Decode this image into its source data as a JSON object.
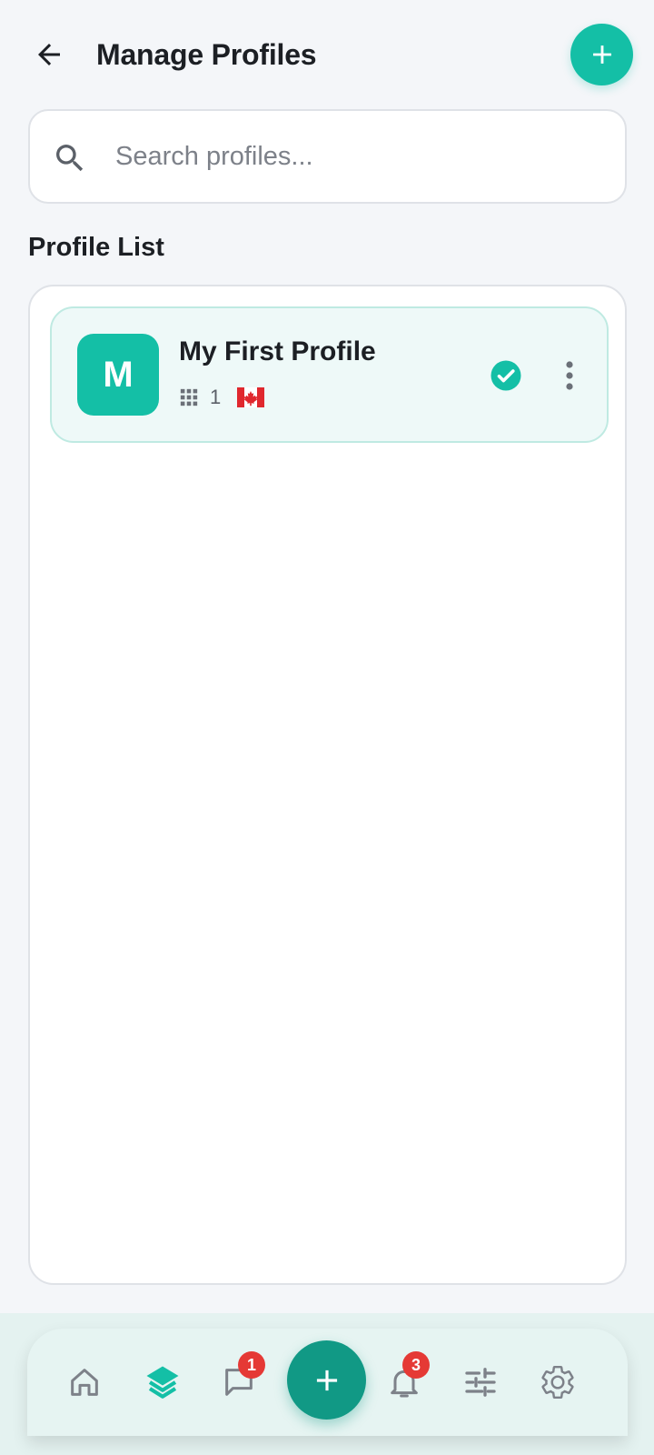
{
  "header": {
    "title": "Manage Profiles",
    "back_icon": "arrow-left-icon",
    "add_icon": "plus-icon"
  },
  "search": {
    "placeholder": "Search profiles...",
    "value": "",
    "icon": "search-icon"
  },
  "section": {
    "title": "Profile List"
  },
  "profiles": [
    {
      "initial": "M",
      "name": "My First Profile",
      "count": "1",
      "count_icon": "grid-icon",
      "region_flag": "flag-canada-icon",
      "active": true,
      "status_icon": "check-circle-icon",
      "menu_icon": "more-vertical-icon"
    }
  ],
  "bottom_nav": {
    "items": [
      {
        "name": "home",
        "icon": "home-icon",
        "active": false
      },
      {
        "name": "profiles",
        "icon": "layers-icon",
        "active": true
      },
      {
        "name": "messages",
        "icon": "chat-icon",
        "badge": "1",
        "active": false
      },
      {
        "name": "notifications",
        "icon": "bell-icon",
        "badge": "3",
        "active": false
      },
      {
        "name": "filters",
        "icon": "sliders-icon",
        "active": false
      },
      {
        "name": "settings",
        "icon": "gear-icon",
        "active": false
      }
    ],
    "fab_icon": "plus-icon"
  },
  "colors": {
    "accent": "#14bfa6",
    "accent_dark": "#119985",
    "badge": "#e53935",
    "background": "#f4f6f9",
    "icon_gray": "#7d8189"
  }
}
